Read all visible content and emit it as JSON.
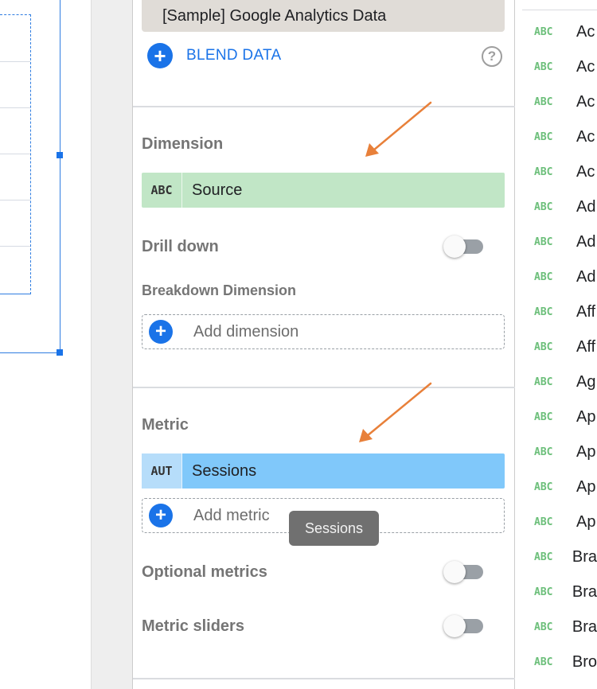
{
  "data_source": {
    "name": "[Sample] Google Analytics Data"
  },
  "blend": {
    "label": "BLEND DATA",
    "help_glyph": "?"
  },
  "dimension": {
    "title": "Dimension",
    "chip": {
      "type": "ABC",
      "name": "Source"
    },
    "drill_down": {
      "label": "Drill down",
      "enabled": false
    },
    "breakdown": {
      "title": "Breakdown Dimension",
      "add_label": "Add dimension"
    }
  },
  "metric": {
    "title": "Metric",
    "chip": {
      "type": "AUT",
      "name": "Sessions"
    },
    "add_label": "Add metric",
    "tooltip": "Sessions",
    "optional_metrics": {
      "label": "Optional metrics",
      "enabled": false
    },
    "metric_sliders": {
      "label": "Metric sliders",
      "enabled": false
    }
  },
  "available_fields": [
    {
      "type": "ABC",
      "name": "Ac"
    },
    {
      "type": "ABC",
      "name": "Ac"
    },
    {
      "type": "ABC",
      "name": "Ac"
    },
    {
      "type": "ABC",
      "name": "Ac"
    },
    {
      "type": "ABC",
      "name": "Ac"
    },
    {
      "type": "ABC",
      "name": "Ad"
    },
    {
      "type": "ABC",
      "name": "Ad"
    },
    {
      "type": "ABC",
      "name": "Ad"
    },
    {
      "type": "ABC",
      "name": "Aff"
    },
    {
      "type": "ABC",
      "name": "Aff"
    },
    {
      "type": "ABC",
      "name": "Ag"
    },
    {
      "type": "ABC",
      "name": "Ap"
    },
    {
      "type": "ABC",
      "name": "Ap"
    },
    {
      "type": "ABC",
      "name": "Ap"
    },
    {
      "type": "ABC",
      "name": "Ap"
    },
    {
      "type": "ABC",
      "name": "Bra"
    },
    {
      "type": "ABC",
      "name": "Bra"
    },
    {
      "type": "ABC",
      "name": "Bra"
    },
    {
      "type": "ABC",
      "name": "Bro"
    }
  ],
  "colors": {
    "accent": "#1a73e8",
    "dimension_chip": "#c1e6c6",
    "metric_chip": "#80c8fa",
    "annotation_arrow": "#e8803a"
  },
  "icons": {
    "add": "plus-circle-icon",
    "help": "help-circle-icon",
    "annotation": "arrow-icon"
  }
}
